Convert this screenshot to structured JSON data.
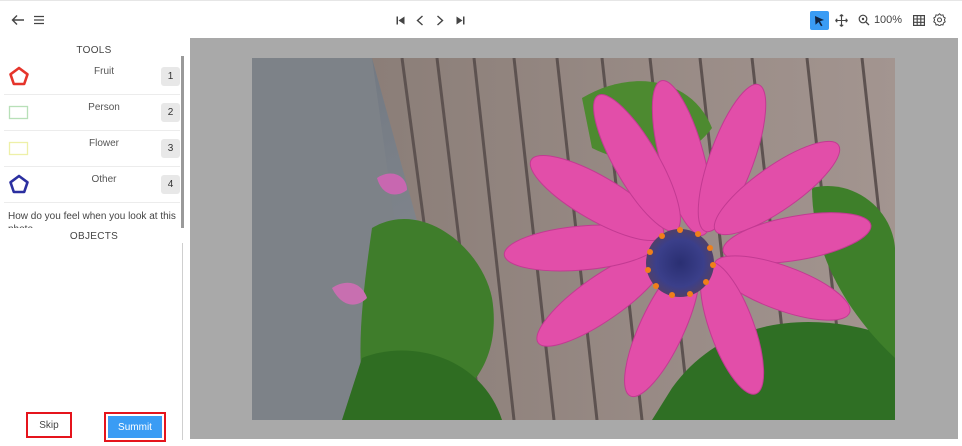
{
  "toolbar": {
    "icons": [
      "back-arrow-icon",
      "menu-icon",
      "first-frame-icon",
      "prev-icon",
      "next-icon",
      "last-frame-icon",
      "pointer-icon",
      "move-icon",
      "zoom-icon",
      "grid-icon",
      "settings-icon"
    ],
    "zoom_label": "100%",
    "active_color": "#3a9cf4"
  },
  "sidebar": {
    "tools_title": "TOOLS",
    "tools": [
      {
        "label": "Fruit",
        "key": "1",
        "shape": "pentagon",
        "color": "#e5342b"
      },
      {
        "label": "Person",
        "key": "2",
        "shape": "rectangle",
        "color": "#b8e0b8"
      },
      {
        "label": "Flower",
        "key": "3",
        "shape": "rectangle",
        "color": "#eef0a8"
      },
      {
        "label": "Other",
        "key": "4",
        "shape": "pentagon",
        "color": "#2b2fa0"
      }
    ],
    "question": "How do you feel when you look at this photo",
    "objects_title": "OBJECTS",
    "skip_label": "Skip",
    "submit_label": "Summit",
    "highlight_color": "#e5141c",
    "submit_color": "#3a9cf4"
  },
  "canvas": {
    "background_color": "#a9a9a9"
  }
}
